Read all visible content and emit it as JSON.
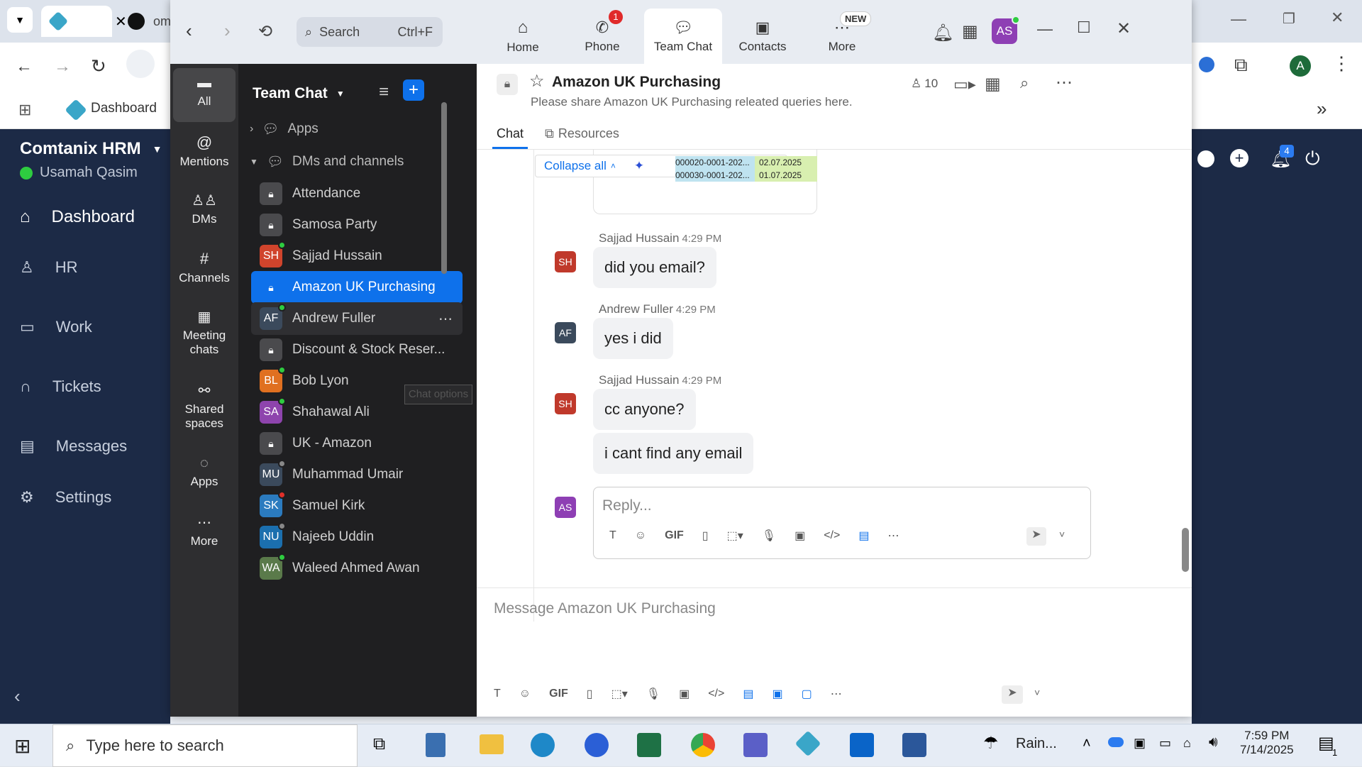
{
  "browser": {
    "tab2_label": "om",
    "bookmark_dashboard": "Dashboard",
    "profile_initial": "A"
  },
  "hrm": {
    "company": "Comtanix HRM",
    "user": "Usamah Qasim",
    "nav": [
      "Dashboard",
      "HR",
      "Work",
      "Tickets",
      "Messages",
      "Settings"
    ],
    "notif_count": "4"
  },
  "zoom": {
    "search_placeholder": "Search",
    "search_shortcut": "Ctrl+F",
    "nav": {
      "home": "Home",
      "phone": "Phone",
      "phone_badge": "1",
      "team_chat": "Team Chat",
      "contacts": "Contacts",
      "more": "More",
      "more_badge": "NEW"
    },
    "avatar": "AS",
    "rail": [
      "All",
      "Mentions",
      "DMs",
      "Channels",
      "Meeting chats",
      "Shared spaces",
      "Apps",
      "More"
    ],
    "list": {
      "title": "Team Chat",
      "apps": "Apps",
      "dms_channels": "DMs and channels",
      "tooltip": "Chat options",
      "items": [
        {
          "name": "Attendance",
          "av": "lock"
        },
        {
          "name": "Samosa Party",
          "av": "lock"
        },
        {
          "name": "Sajjad Hussain",
          "av": "SH",
          "color": "#d0442c"
        },
        {
          "name": "Amazon UK Purchasing",
          "av": "lock"
        },
        {
          "name": "Andrew Fuller",
          "av": "AF",
          "color": "#3b4a5c"
        },
        {
          "name": "Discount & Stock Reser...",
          "av": "lock"
        },
        {
          "name": "Bob Lyon",
          "av": "BL",
          "color": "#e07020"
        },
        {
          "name": "Shahawal Ali",
          "av": "SA",
          "color": "#8e44ad"
        },
        {
          "name": "UK - Amazon",
          "av": "lock"
        },
        {
          "name": "Muhammad Umair",
          "av": "MU",
          "color": "#3b4a5c"
        },
        {
          "name": "Samuel Kirk",
          "av": "SK",
          "color": "#2b7bbf"
        },
        {
          "name": "Najeeb Uddin",
          "av": "NU",
          "color": "#1b6fae"
        },
        {
          "name": "Waleed Ahmed Awan",
          "av": "WA",
          "color": "#5a7a4a"
        }
      ]
    },
    "channel": {
      "name": "Amazon UK Purchasing",
      "desc": "Please share Amazon UK Purchasing releated queries here.",
      "members": "10",
      "tab_chat": "Chat",
      "tab_resources": "Resources"
    },
    "attachment": {
      "collapse": "Collapse all",
      "row1_a": "000020-0001-202...",
      "row1_b": "02.07.2025",
      "row2_a": "000030-0001-202...",
      "row2_b": "01.07.2025"
    },
    "messages": [
      {
        "sender": "Sajjad Hussain",
        "time": "4:29 PM",
        "initials": "SH",
        "color": "#c0392b",
        "texts": [
          "did you email?"
        ]
      },
      {
        "sender": "Andrew Fuller",
        "time": "4:29 PM",
        "initials": "AF",
        "color": "#3b4a5c",
        "texts": [
          "yes i did"
        ]
      },
      {
        "sender": "Sajjad Hussain",
        "time": "4:29 PM",
        "initials": "SH",
        "color": "#c0392b",
        "texts": [
          "cc anyone?",
          "i cant find any email"
        ]
      }
    ],
    "reply": {
      "initials": "AS",
      "placeholder": "Reply..."
    },
    "composer": {
      "placeholder": "Message Amazon UK Purchasing"
    }
  },
  "taskbar": {
    "search": "Type here to search",
    "weather": "Rain...",
    "time": "7:59 PM",
    "date": "7/14/2025",
    "notif": "1"
  }
}
